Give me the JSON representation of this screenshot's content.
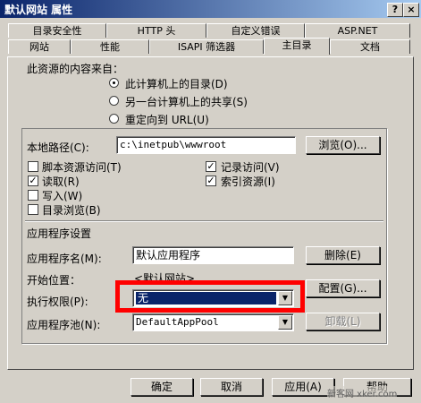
{
  "window": {
    "title": "默认网站 属性",
    "help_btn": "?",
    "close_btn": "×"
  },
  "tabs_row1": [
    "目录安全性",
    "HTTP 头",
    "自定义错误",
    "ASP.NET"
  ],
  "tabs_row2": [
    "网站",
    "性能",
    "ISAPI 筛选器",
    "主目录",
    "文档"
  ],
  "source": {
    "label": "此资源的内容来自：",
    "options": [
      "此计算机上的目录(D)",
      "另一台计算机上的共享(S)",
      "重定向到 URL(U)"
    ]
  },
  "local_path": {
    "label": "本地路径(C):",
    "value": "c:\\inetpub\\wwwroot",
    "browse_btn": "浏览(O)..."
  },
  "perms": {
    "script_access": "脚本资源访问(T)",
    "read": "读取(R)",
    "write": "写入(W)",
    "dir_browse": "目录浏览(B)",
    "log_visits": "记录访问(V)",
    "index_resource": "索引资源(I)"
  },
  "app_settings": {
    "header": "应用程序设置",
    "app_name_label": "应用程序名(M):",
    "app_name_value": "默认应用程序",
    "remove_btn": "删除(E)",
    "start_label": "开始位置：",
    "start_value": "<默认网站>",
    "config_btn": "配置(G)...",
    "exec_label": "执行权限(P):",
    "exec_value": "无",
    "pool_label": "应用程序池(N):",
    "pool_value": "DefaultAppPool",
    "unload_btn": "卸载(L)"
  },
  "buttons": {
    "ok": "确定",
    "cancel": "取消",
    "apply": "应用(A)",
    "help": "帮助"
  },
  "watermark": "新客网 xker.com",
  "colors": {
    "titlebar_start": "#0a246a",
    "highlight": "#0a246a",
    "annotation_red": "#ff0000"
  }
}
